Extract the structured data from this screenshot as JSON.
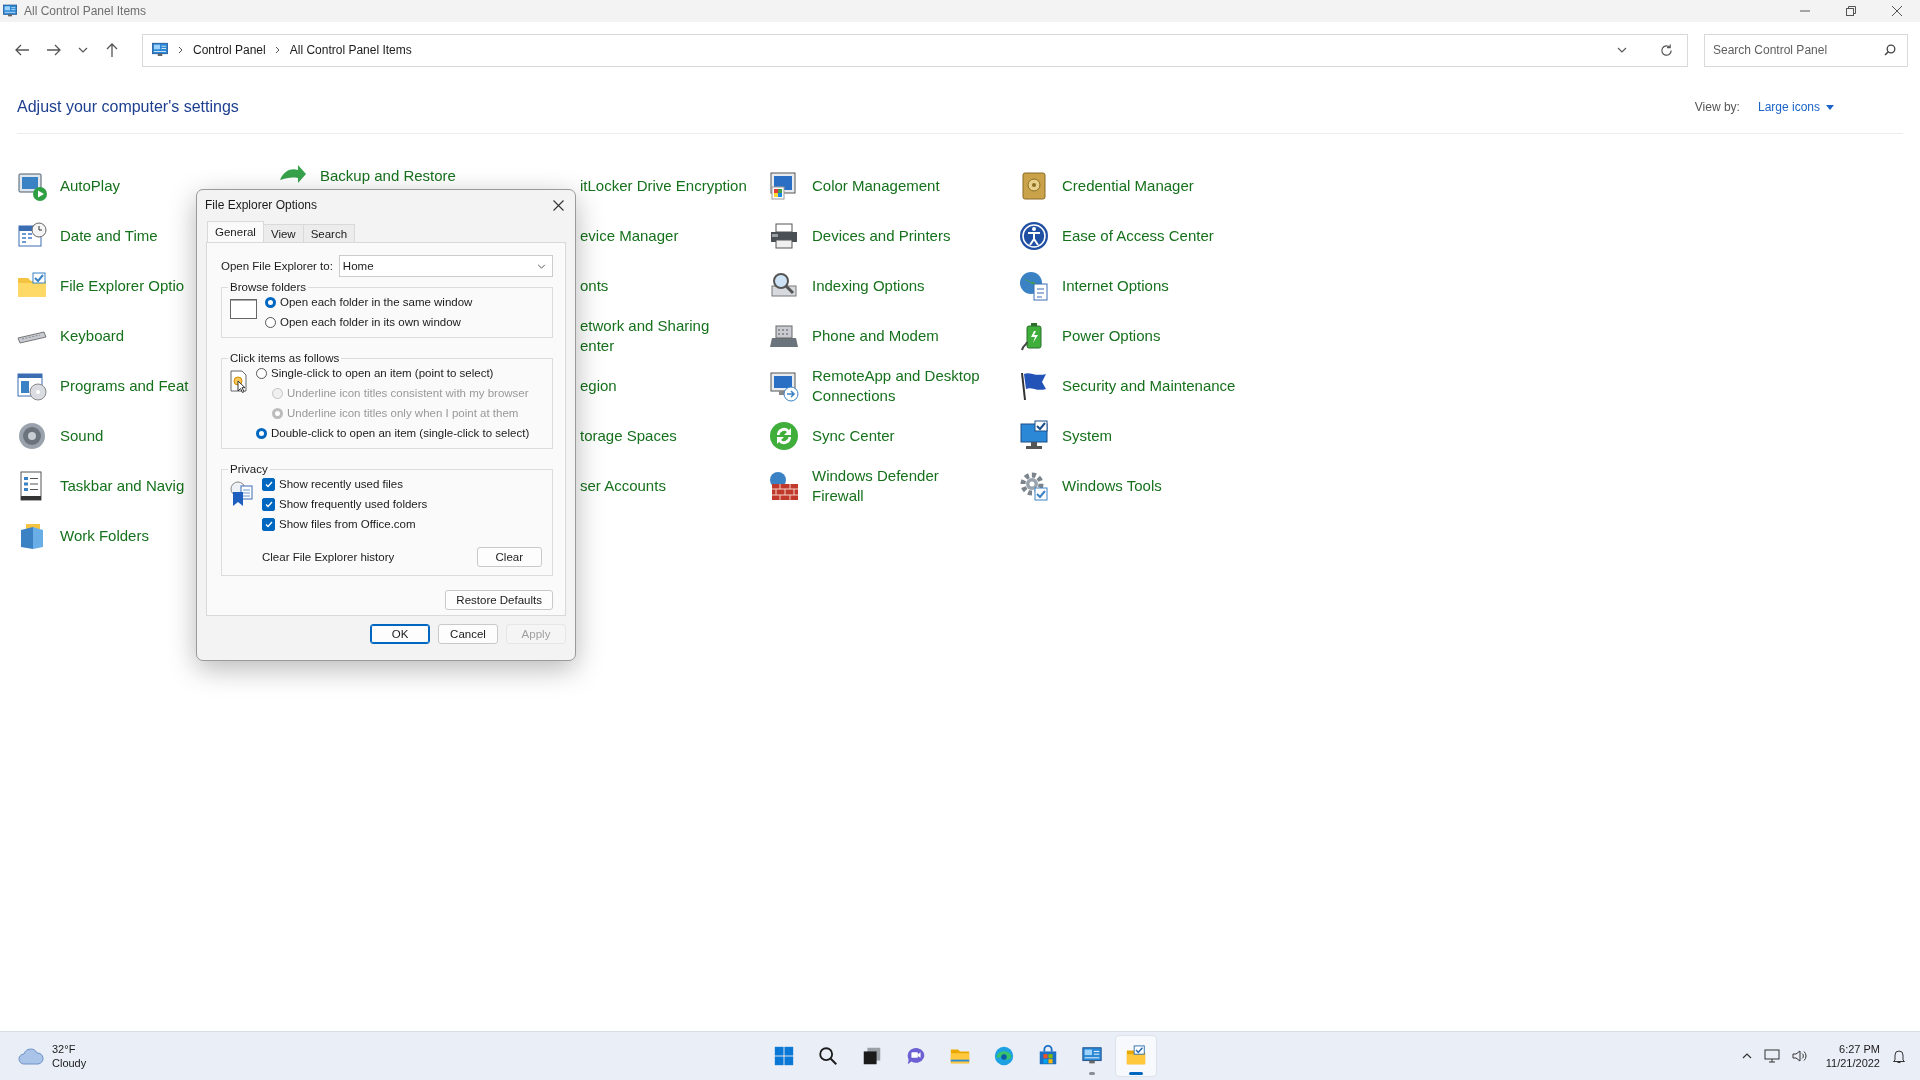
{
  "window": {
    "title": "All Control Panel Items"
  },
  "address_bar": {
    "breadcrumb": [
      "Control Panel",
      "All Control Panel Items"
    ]
  },
  "search": {
    "placeholder": "Search Control Panel"
  },
  "header": {
    "title": "Adjust your computer's settings",
    "view_by_label": "View by:",
    "view_by_value": "Large icons"
  },
  "columns": [
    {
      "items": [
        {
          "label": "AutoPlay"
        },
        {
          "label": "Date and Time"
        },
        {
          "label": "File Explorer Optio"
        },
        {
          "label": "Keyboard"
        },
        {
          "label": "Programs and Feat"
        },
        {
          "label": "Sound"
        },
        {
          "label": "Taskbar and Navig"
        },
        {
          "label": "Work Folders"
        }
      ]
    },
    {
      "items": [
        {
          "label": "Backup and Restore"
        }
      ]
    },
    {
      "items": [
        {
          "label": "itLocker Drive Encryption"
        },
        {
          "label": "evice Manager"
        },
        {
          "label": "onts"
        },
        {
          "label": "etwork and Sharing\nenter"
        },
        {
          "label": "egion"
        },
        {
          "label": "torage Spaces"
        },
        {
          "label": "ser Accounts"
        }
      ]
    },
    {
      "items": [
        {
          "label": "Color Management"
        },
        {
          "label": "Devices and Printers"
        },
        {
          "label": "Indexing Options"
        },
        {
          "label": "Phone and Modem"
        },
        {
          "label": "RemoteApp and Desktop\nConnections"
        },
        {
          "label": "Sync Center"
        },
        {
          "label": "Windows Defender\nFirewall"
        }
      ]
    },
    {
      "items": [
        {
          "label": "Credential Manager"
        },
        {
          "label": "Ease of Access Center"
        },
        {
          "label": "Internet Options"
        },
        {
          "label": "Power Options"
        },
        {
          "label": "Security and Maintenance"
        },
        {
          "label": "System"
        },
        {
          "label": "Windows Tools"
        }
      ]
    }
  ],
  "dialog": {
    "title": "File Explorer Options",
    "tabs": [
      {
        "label": "General",
        "selected": true
      },
      {
        "label": "View",
        "selected": false
      },
      {
        "label": "Search",
        "selected": false
      }
    ],
    "open_to": {
      "label": "Open File Explorer to:",
      "value": "Home"
    },
    "browse_folders": {
      "title": "Browse folders",
      "options": [
        {
          "label": "Open each folder in the same window",
          "selected": true,
          "disabled": false
        },
        {
          "label": "Open each folder in its own window",
          "selected": false,
          "disabled": false
        }
      ]
    },
    "click_items": {
      "title": "Click items as follows",
      "options": [
        {
          "label": "Single-click to open an item (point to select)",
          "selected": false,
          "disabled": false,
          "children": [
            {
              "label": "Underline icon titles consistent with my browser",
              "selected": false,
              "disabled": true
            },
            {
              "label": "Underline icon titles only when I point at them",
              "selected": true,
              "disabled": true
            }
          ]
        },
        {
          "label": "Double-click to open an item (single-click to select)",
          "selected": true,
          "disabled": false
        }
      ]
    },
    "privacy": {
      "title": "Privacy",
      "checkboxes": [
        {
          "label": "Show recently used files",
          "checked": true
        },
        {
          "label": "Show frequently used folders",
          "checked": true
        },
        {
          "label": "Show files from Office.com",
          "checked": true
        }
      ],
      "clear_label": "Clear File Explorer history",
      "clear_button": "Clear"
    },
    "restore_button": "Restore Defaults",
    "buttons": [
      {
        "label": "OK",
        "default": true,
        "disabled": false
      },
      {
        "label": "Cancel",
        "default": false,
        "disabled": false
      },
      {
        "label": "Apply",
        "default": false,
        "disabled": true
      }
    ]
  },
  "taskbar": {
    "weather": {
      "temperature": "32°F",
      "condition": "Cloudy"
    },
    "apps": [
      {
        "kind": "start",
        "open": false,
        "selected": false
      },
      {
        "kind": "search",
        "open": false,
        "selected": false
      },
      {
        "kind": "task-view",
        "open": false,
        "selected": false
      },
      {
        "kind": "chat",
        "open": false,
        "selected": false
      },
      {
        "kind": "files",
        "open": false,
        "selected": false
      },
      {
        "kind": "browser",
        "open": false,
        "selected": false
      },
      {
        "kind": "store",
        "open": false,
        "selected": false
      },
      {
        "kind": "control-panel",
        "open": true,
        "selected": false
      },
      {
        "kind": "options",
        "open": true,
        "selected": true
      }
    ],
    "clock": {
      "time": "6:27 PM",
      "date": "11/21/2022"
    }
  }
}
